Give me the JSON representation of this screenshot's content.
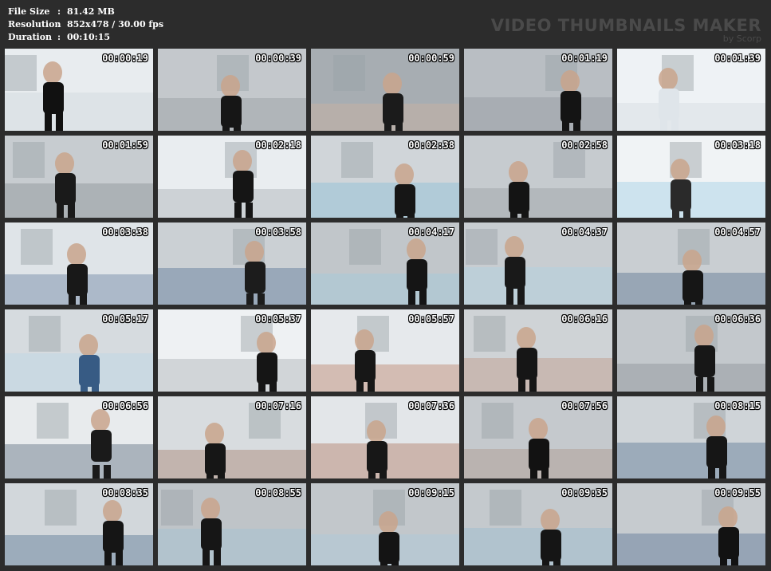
{
  "meta": {
    "file_size_label": "File Size",
    "file_size_value": "81.42 MB",
    "resolution_label": "Resolution",
    "resolution_value": "852x478 / 30.00 fps",
    "duration_label": "Duration",
    "duration_value": "00:10:15",
    "separator": ":"
  },
  "brand": {
    "title": "VIDEO THUMBNAILS MAKER",
    "subtitle": "by Scorp"
  },
  "thumbnails": [
    {
      "time": "00:00:19",
      "palette": [
        "#e8ecef",
        "#111111",
        "#c9d3da"
      ]
    },
    {
      "time": "00:00:39",
      "palette": [
        "#c4c8cc",
        "#161616",
        "#8b9196"
      ]
    },
    {
      "time": "00:00:59",
      "palette": [
        "#a7adb2",
        "#1b1b1b",
        "#d7b49c"
      ]
    },
    {
      "time": "00:01:19",
      "palette": [
        "#b9bec3",
        "#141414",
        "#8a8f94"
      ]
    },
    {
      "time": "00:01:39",
      "palette": [
        "#eef2f5",
        "#dfe5ea",
        "#cfd6dc"
      ]
    },
    {
      "time": "00:01:59",
      "palette": [
        "#c7ccd0",
        "#1a1a1a",
        "#7c8186"
      ]
    },
    {
      "time": "00:02:18",
      "palette": [
        "#e9edf0",
        "#151515",
        "#9ba1a6"
      ]
    },
    {
      "time": "00:02:38",
      "palette": [
        "#d0d5d9",
        "#161616",
        "#79b9d6"
      ]
    },
    {
      "time": "00:02:58",
      "palette": [
        "#c6cbcf",
        "#141414",
        "#8f9499"
      ]
    },
    {
      "time": "00:03:18",
      "palette": [
        "#f0f3f5",
        "#2a2a2a",
        "#8cc7e2"
      ]
    },
    {
      "time": "00:03:38",
      "palette": [
        "#dfe4e8",
        "#181818",
        "#4c6b8e"
      ]
    },
    {
      "time": "00:03:58",
      "palette": [
        "#cbd0d4",
        "#1c1c1c",
        "#3d5f86"
      ]
    },
    {
      "time": "00:04:17",
      "palette": [
        "#c1c6ca",
        "#151515",
        "#9ccbe1"
      ]
    },
    {
      "time": "00:04:37",
      "palette": [
        "#c8cdd1",
        "#191919",
        "#a9d3e6"
      ]
    },
    {
      "time": "00:04:57",
      "palette": [
        "#c9ced2",
        "#161616",
        "#3b5b82"
      ]
    },
    {
      "time": "00:05:17",
      "palette": [
        "#d6dbdf",
        "#375b84",
        "#b4d6e8"
      ]
    },
    {
      "time": "00:05:37",
      "palette": [
        "#eef1f3",
        "#151515",
        "#9aa0a5"
      ]
    },
    {
      "time": "00:05:57",
      "palette": [
        "#e6e9ec",
        "#171717",
        "#b0694b"
      ]
    },
    {
      "time": "00:06:16",
      "palette": [
        "#cfd3d6",
        "#161616",
        "#b98a74"
      ]
    },
    {
      "time": "00:06:36",
      "palette": [
        "#c3c8cc",
        "#171717",
        "#7e8489"
      ]
    },
    {
      "time": "00:06:56",
      "palette": [
        "#e8ebed",
        "#1a1a1a",
        "#3a4c63"
      ]
    },
    {
      "time": "00:07:16",
      "palette": [
        "#d8dcdf",
        "#161616",
        "#9a6a54"
      ]
    },
    {
      "time": "00:07:36",
      "palette": [
        "#e3e6e9",
        "#171717",
        "#a05d42"
      ]
    },
    {
      "time": "00:07:56",
      "palette": [
        "#c5c9cd",
        "#121212",
        "#a58a7c"
      ]
    },
    {
      "time": "00:08:15",
      "palette": [
        "#cfd4d8",
        "#161616",
        "#3c5e84"
      ]
    },
    {
      "time": "00:08:35",
      "palette": [
        "#d2d7db",
        "#151515",
        "#3a5d82"
      ]
    },
    {
      "time": "00:08:55",
      "palette": [
        "#bfc4c8",
        "#161616",
        "#9bc3d8"
      ]
    },
    {
      "time": "00:09:15",
      "palette": [
        "#c2c7cb",
        "#141414",
        "#a6cbe0"
      ]
    },
    {
      "time": "00:09:35",
      "palette": [
        "#c4c9cd",
        "#151515",
        "#8fb8d1"
      ]
    },
    {
      "time": "00:09:55",
      "palette": [
        "#c6cbcf",
        "#121212",
        "#3b5d83"
      ]
    }
  ]
}
